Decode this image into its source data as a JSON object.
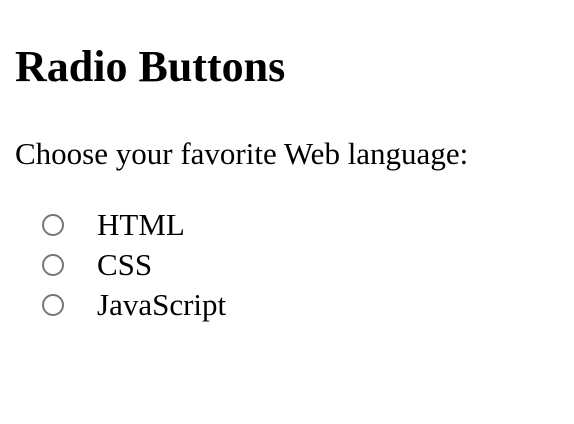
{
  "page": {
    "title": "Radio Buttons",
    "prompt": "Choose your favorite Web language:"
  },
  "form": {
    "options": [
      {
        "label": "HTML",
        "selected": false
      },
      {
        "label": "CSS",
        "selected": false
      },
      {
        "label": "JavaScript",
        "selected": false
      }
    ]
  },
  "colors": {
    "text": "#000000",
    "radio_border": "#767676",
    "background": "#ffffff"
  }
}
